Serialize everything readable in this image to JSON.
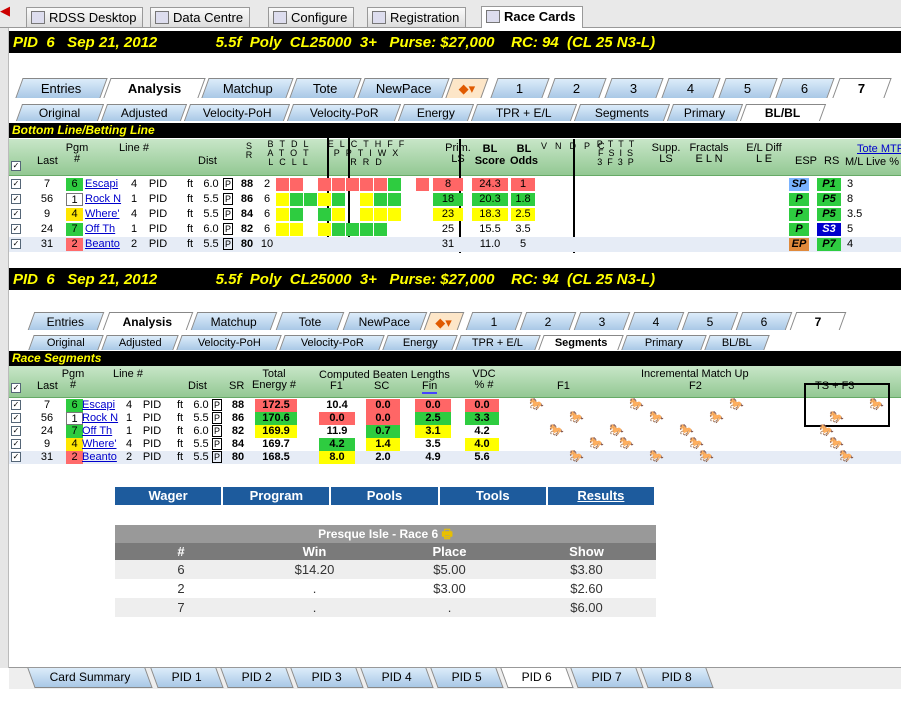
{
  "top_tabs": [
    "RDSS Desktop",
    "Data Centre",
    "Configure",
    "Registration",
    "Race Cards"
  ],
  "race_header": "PID  6   Sep 21, 2012              5.5f  Poly  CL25000  3+   Purse: $27,000    RC: 94  (CL 25 N3-L)",
  "main_tabs": [
    "Entries",
    "Analysis",
    "Matchup",
    "Tote",
    "NewPace",
    "",
    "1",
    "2",
    "3",
    "4",
    "5",
    "6",
    "7"
  ],
  "sub_tabs": [
    "Original",
    "Adjusted",
    "Velocity-PoH",
    "Velocity-PoR",
    "Energy",
    "TPR + E/L",
    "Segments",
    "Primary",
    "BL/BL"
  ],
  "section1_title": "Bottom Line/Betting Line",
  "section2_title": "Race Segments",
  "tote_label": "Tote MTP:",
  "col_headers": {
    "last": "Last",
    "pgm": "Pgm #",
    "line": "Line #",
    "dist": "Dist",
    "prim": "Prim. LS",
    "bl_score": "BL Score",
    "bl_odds": "BL Odds",
    "supp": "Supp. LS",
    "fractals": "Fractals E L N",
    "eldiff": "E/L Diff L E",
    "esp": "ESP",
    "rs": "RS",
    "ml": "M/L Live %"
  },
  "rows1": [
    {
      "last": "7",
      "pgm": "6",
      "name": "Escapi",
      "line": "4",
      "track": "PID",
      "surf": "ft",
      "dist": "6.0",
      "s": "P",
      "sr": "88",
      "b": "2",
      "prim": "8",
      "bls": "24.3",
      "blo": "1",
      "esp": "SP",
      "rs": "P1",
      "ml": "3"
    },
    {
      "last": "56",
      "pgm": "1",
      "name": "Rock N",
      "line": "1",
      "track": "PID",
      "surf": "ft",
      "dist": "5.5",
      "s": "P",
      "sr": "86",
      "b": "6",
      "prim": "18",
      "bls": "20.3",
      "blo": "1.8",
      "esp": "P",
      "rs": "P5",
      "ml": "8"
    },
    {
      "last": "9",
      "pgm": "4",
      "name": "Where'",
      "line": "4",
      "track": "PID",
      "surf": "ft",
      "dist": "5.5",
      "s": "P",
      "sr": "84",
      "b": "6",
      "prim": "23",
      "bls": "18.3",
      "blo": "2.5",
      "esp": "P",
      "rs": "P5",
      "ml": "3.5"
    },
    {
      "last": "24",
      "pgm": "7",
      "name": "Off Th",
      "line": "1",
      "track": "PID",
      "surf": "ft",
      "dist": "6.0",
      "s": "P",
      "sr": "82",
      "b": "6",
      "prim": "25",
      "bls": "15.5",
      "blo": "3.5",
      "esp": "P",
      "rs": "S3",
      "ml": "5"
    },
    {
      "last": "31",
      "pgm": "2",
      "name": "Beanto",
      "line": "2",
      "track": "PID",
      "surf": "ft",
      "dist": "5.5",
      "s": "P",
      "sr": "80",
      "b": "10",
      "prim": "31",
      "bls": "11.0",
      "blo": "5",
      "esp": "EP",
      "rs": "P7",
      "ml": "4"
    }
  ],
  "seg_headers": {
    "sr": "SR",
    "total": "Total Energy #",
    "computed": "Computed Beaten Lengths",
    "f1": "F1",
    "sc": "SC",
    "fin": "Fin",
    "vdc": "VDC % #",
    "g_f1": "F1",
    "incr": "Incremental Match Up",
    "f2": "F2",
    "tsf3": "TS + F3"
  },
  "rows2": [
    {
      "last": "7",
      "pgm": "6",
      "name": "Escapi",
      "line": "4",
      "track": "PID",
      "surf": "ft",
      "dist": "6.0",
      "s": "P",
      "sr": "88",
      "te": "172.5",
      "f1": "10.4",
      "sc": "0.0",
      "fin": "0.0",
      "vdc": "0.0"
    },
    {
      "last": "56",
      "pgm": "1",
      "name": "Rock N",
      "line": "1",
      "track": "PID",
      "surf": "ft",
      "dist": "5.5",
      "s": "P",
      "sr": "86",
      "te": "170.6",
      "f1": "0.0",
      "sc": "0.0",
      "fin": "2.5",
      "vdc": "3.3"
    },
    {
      "last": "24",
      "pgm": "7",
      "name": "Off Th",
      "line": "1",
      "track": "PID",
      "surf": "ft",
      "dist": "6.0",
      "s": "P",
      "sr": "82",
      "te": "169.9",
      "f1": "11.9",
      "sc": "0.7",
      "fin": "3.1",
      "vdc": "4.2"
    },
    {
      "last": "9",
      "pgm": "4",
      "name": "Where'",
      "line": "4",
      "track": "PID",
      "surf": "ft",
      "dist": "5.5",
      "s": "P",
      "sr": "84",
      "te": "169.7",
      "f1": "4.2",
      "sc": "1.4",
      "fin": "3.5",
      "vdc": "4.0"
    },
    {
      "last": "31",
      "pgm": "2",
      "name": "Beanto",
      "line": "2",
      "track": "PID",
      "surf": "ft",
      "dist": "5.5",
      "s": "P",
      "sr": "80",
      "te": "168.5",
      "f1": "8.0",
      "sc": "2.0",
      "fin": "4.9",
      "vdc": "5.6"
    }
  ],
  "results": {
    "nav": [
      "Wager",
      "Program",
      "Pools",
      "Tools",
      "Results"
    ],
    "title": "Presque Isle - Race 6",
    "cols": [
      "#",
      "Win",
      "Place",
      "Show"
    ],
    "rows": [
      [
        "6",
        "$14.20",
        "$5.00",
        "$3.80"
      ],
      [
        "2",
        ".",
        "$3.00",
        "$2.60"
      ],
      [
        "7",
        ".",
        ".",
        "$6.00"
      ]
    ]
  },
  "bottom_tabs": [
    "Card Summary",
    "PID 1",
    "PID 2",
    "PID 3",
    "PID 4",
    "PID 5",
    "PID 6",
    "PID 7",
    "PID 8"
  ]
}
